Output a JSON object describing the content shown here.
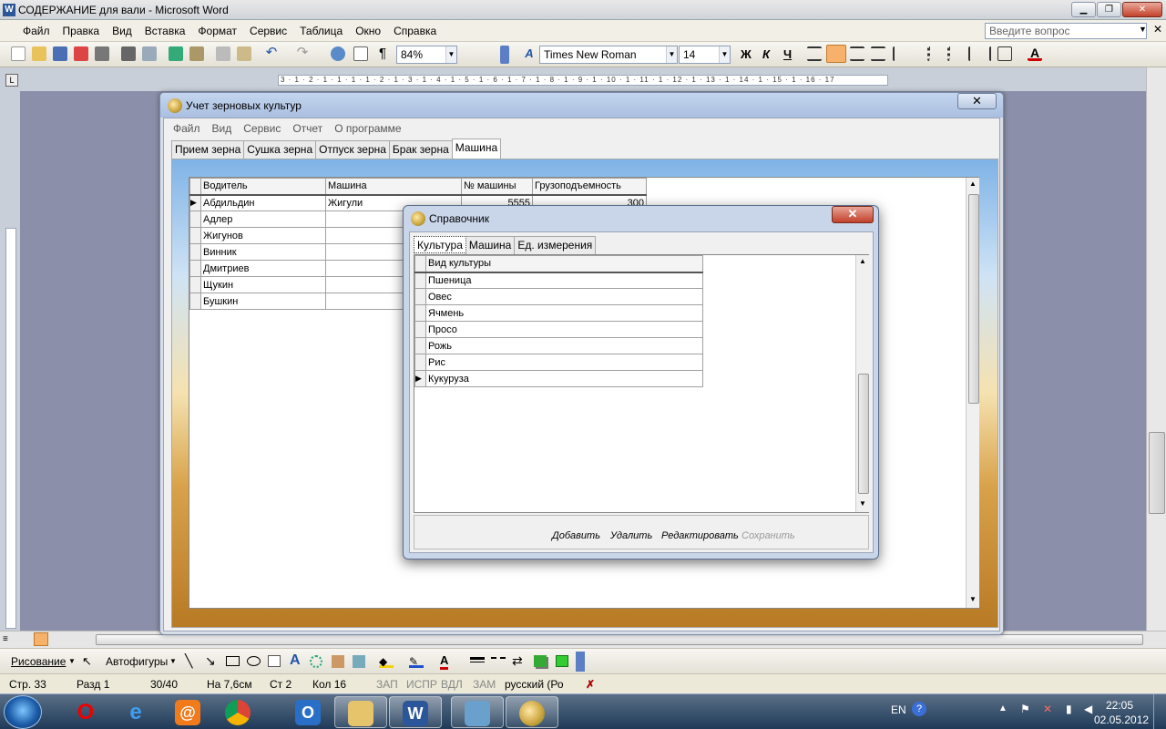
{
  "word": {
    "title": "СОДЕРЖАНИЕ для вали - Microsoft Word",
    "menu": [
      "Файл",
      "Правка",
      "Вид",
      "Вставка",
      "Формат",
      "Сервис",
      "Таблица",
      "Окно",
      "Справка"
    ],
    "help_placeholder": "Введите вопрос",
    "zoom": "84%",
    "font": "Times New Roman",
    "font_size": "14",
    "bold": "Ж",
    "italic": "К",
    "underline": "Ч",
    "paragraph_mark": "¶",
    "ruler_text": "3 · 1 · 2 · 1 · 1 · 1 · 1 · 2 · 1 · 3 · 1 · 4 · 1 · 5 · 1 · 6 · 1 · 7 · 1 · 8 · 1 · 9 · 1 · 10 · 1 · 11 · 1 · 12 · 1 · 13 · 1 · 14 · 1 · 15 · 1 · 16 · 17"
  },
  "drawbar": {
    "drawing": "Рисование",
    "autoshapes": "Автофигуры"
  },
  "status": {
    "page": "Стр. 33",
    "section": "Разд 1",
    "pages": "30/40",
    "at": "На 7,6см",
    "line": "Ст 2",
    "col": "Кол 16",
    "rec": "ЗАП",
    "trk": "ИСПР",
    "ext": "ВДЛ",
    "ovr": "ЗАМ",
    "lang": "русский (Ро"
  },
  "app": {
    "title": "Учет зерновых культур",
    "menu": [
      "Файл",
      "Вид",
      "Сервис",
      "Отчет",
      "О программе"
    ],
    "tabs": [
      "Прием зерна",
      "Сушка зерна",
      "Отпуск зерна",
      "Брак зерна",
      "Машина"
    ],
    "selected_tab": "Машина",
    "grid": {
      "columns": [
        "Водитель",
        "Машина",
        "№ машины",
        "Грузоподъемность"
      ],
      "rows": [
        [
          "Абдильдин",
          "Жигули",
          "5555",
          "300"
        ],
        [
          "Адлер",
          "",
          "",
          ""
        ],
        [
          "Жигунов",
          "",
          "",
          ""
        ],
        [
          "Винник",
          "",
          "",
          ""
        ],
        [
          "Дмитриев",
          "",
          "",
          ""
        ],
        [
          "Щукин",
          "",
          "",
          ""
        ],
        [
          "Бушкин",
          "",
          "",
          ""
        ]
      ]
    }
  },
  "dialog": {
    "title": "Справочник",
    "tabs": [
      "Культура",
      "Машина",
      "Ед. измерения"
    ],
    "selected_tab": "Культура",
    "column": "Вид культуры",
    "rows": [
      "Пшеница",
      "Овес",
      "Ячмень",
      "Просо",
      "Рожь",
      "Рис",
      "Кукуруза"
    ],
    "current_row": "Кукуруза",
    "actions": {
      "add": "Добавить",
      "delete": "Удалить",
      "edit": "Редактировать",
      "save": "Сохранить"
    }
  },
  "taskbar": {
    "lang": "EN",
    "time": "22:05",
    "date": "02.05.2012"
  },
  "colors": {
    "accent": "#f6b26b",
    "title_blue": "#aabfe0",
    "close_red": "#c1402a"
  }
}
